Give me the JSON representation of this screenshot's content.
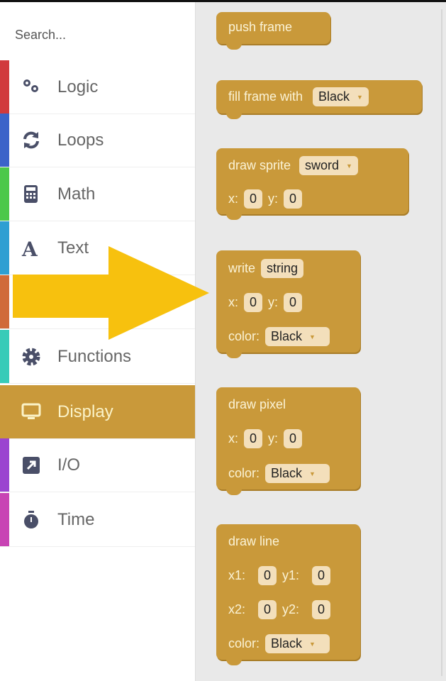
{
  "search": {
    "placeholder": "Search..."
  },
  "categories": [
    {
      "label": "Logic",
      "icon": "cogs-icon",
      "color": "#d13a3d"
    },
    {
      "label": "Loops",
      "icon": "sync-icon",
      "color": "#3b63c9"
    },
    {
      "label": "Math",
      "icon": "calculator-icon",
      "color": "#4cc84a"
    },
    {
      "label": "Text",
      "icon": "font-icon",
      "color": "#2f9fd2"
    },
    {
      "label": "",
      "icon": "",
      "color": "#d06a3a"
    },
    {
      "label": "Functions",
      "icon": "gear-icon",
      "color": "#38cbb8"
    },
    {
      "label": "Display",
      "icon": "monitor-icon",
      "color": "#c9993a",
      "selected": true
    },
    {
      "label": "I/O",
      "icon": "external-link-square-icon",
      "color": "#9b44d0"
    },
    {
      "label": "Time",
      "icon": "stopwatch-icon",
      "color": "#c843b4"
    }
  ],
  "blocks": {
    "push_frame": {
      "label": "push frame"
    },
    "fill_frame": {
      "label": "fill frame with",
      "color": "Black"
    },
    "draw_sprite": {
      "label": "draw sprite",
      "sprite": "sword",
      "x_label": "x:",
      "x": "0",
      "y_label": "y:",
      "y": "0"
    },
    "write": {
      "label": "write",
      "text": "string",
      "x_label": "x:",
      "x": "0",
      "y_label": "y:",
      "y": "0",
      "color_label": "color:",
      "color": "Black"
    },
    "draw_pixel": {
      "label": "draw pixel",
      "x_label": "x:",
      "x": "0",
      "y_label": "y:",
      "y": "0",
      "color_label": "color:",
      "color": "Black"
    },
    "draw_line": {
      "label": "draw line",
      "x1_label": "x1:",
      "x1": "0",
      "y1_label": "y1:",
      "y1": "0",
      "x2_label": "x2:",
      "x2": "0",
      "y2_label": "y2:",
      "y2": "0",
      "color_label": "color:",
      "color": "Black"
    }
  },
  "colors": {
    "block": "#c9993a",
    "arrow": "#f7c10e",
    "field": "#f3dfbb"
  }
}
